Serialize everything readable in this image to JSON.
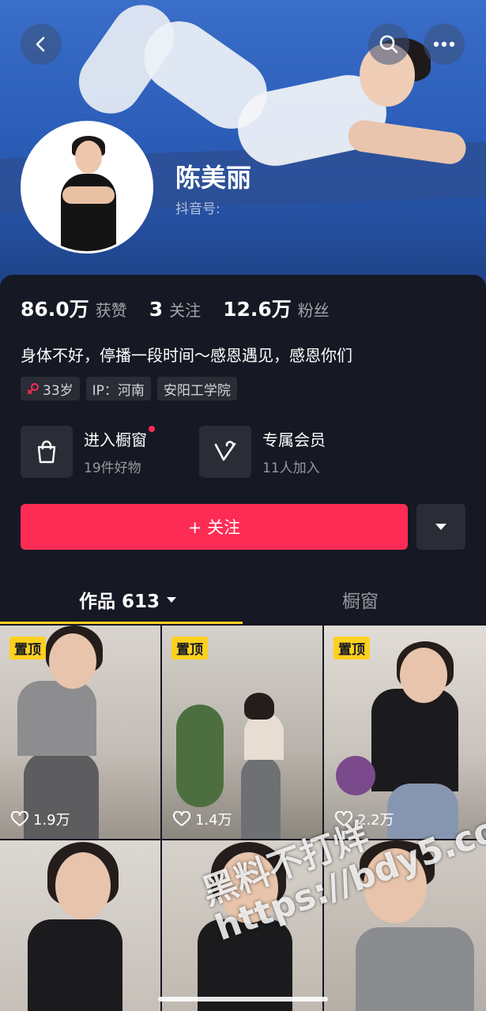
{
  "profile": {
    "name": "陈美丽",
    "douyin_id_label": "抖音号:"
  },
  "stats": {
    "likes_value": "86.0万",
    "likes_label": "获赞",
    "following_value": "3",
    "following_label": "关注",
    "followers_value": "12.6万",
    "followers_label": "粉丝"
  },
  "bio": "身体不好，停播一段时间～感恩遇见，感恩你们",
  "tags": {
    "age": "33岁",
    "ip": "IP：河南",
    "school": "安阳工学院"
  },
  "features": {
    "shop_title": "进入橱窗",
    "shop_sub": "19件好物",
    "vip_title": "专属会员",
    "vip_sub": "11人加入"
  },
  "actions": {
    "follow_label": "+ 关注"
  },
  "tabs": {
    "works_label": "作品 613",
    "shop_label": "橱窗"
  },
  "videos": [
    {
      "pinned_label": "置顶",
      "likes": "1.9万"
    },
    {
      "pinned_label": "置顶",
      "likes": "1.4万"
    },
    {
      "pinned_label": "置顶",
      "likes": "2.2万"
    }
  ],
  "watermark": {
    "line1": "黑料不打烊",
    "line2": "https://bdy5.co"
  },
  "colors": {
    "accent": "#fe2c55",
    "pin": "#fbd11f",
    "background": "#161823"
  }
}
